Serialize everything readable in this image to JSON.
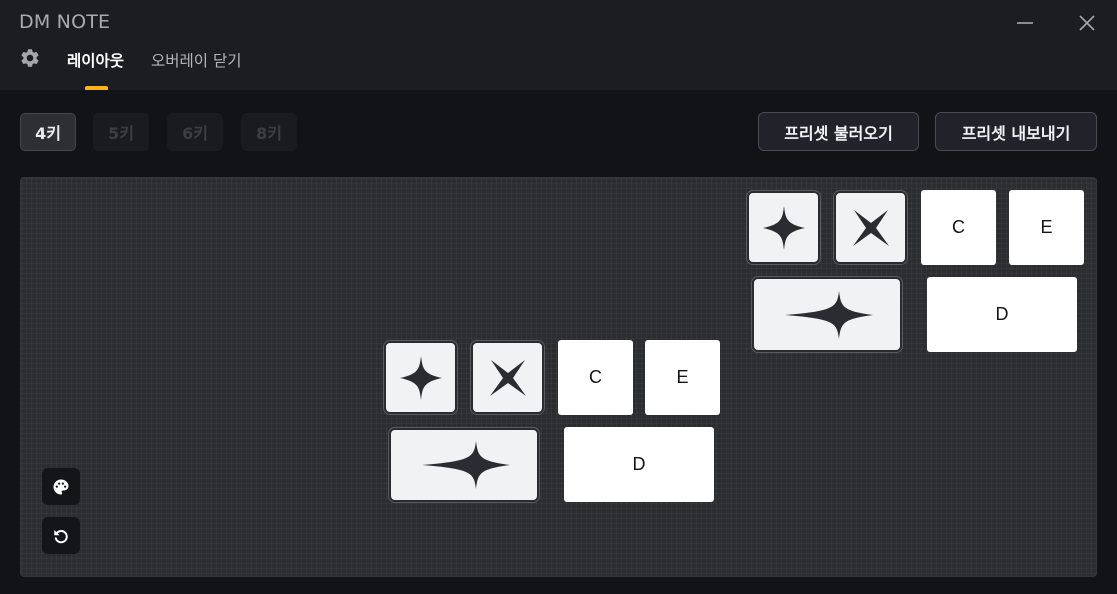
{
  "window": {
    "title": "DM NOTE",
    "minimize_icon": "minimize-icon",
    "close_icon": "close-icon"
  },
  "nav": {
    "settings_icon": "gear-icon",
    "tabs": [
      {
        "label": "레이아웃",
        "active": true
      },
      {
        "label": "오버레이 닫기",
        "active": false
      }
    ],
    "accent_color": "#ffb31a"
  },
  "key_modes": [
    {
      "label": "4키",
      "active": true
    },
    {
      "label": "5키",
      "active": false
    },
    {
      "label": "6키",
      "active": false
    },
    {
      "label": "8키",
      "active": false
    }
  ],
  "presets": {
    "load_label": "프리셋 불러오기",
    "export_label": "프리셋 내보내기"
  },
  "canvas": {
    "key_groups": [
      {
        "keys": [
          {
            "type": "icon",
            "icon": "four-point-star-icon"
          },
          {
            "type": "icon",
            "icon": "x-cross-icon"
          },
          {
            "type": "text",
            "label": "C"
          },
          {
            "type": "text",
            "label": "E"
          },
          {
            "type": "icon",
            "icon": "wide-star-icon"
          },
          {
            "type": "text",
            "label": "D"
          }
        ]
      },
      {
        "keys": [
          {
            "type": "icon",
            "icon": "four-point-star-icon"
          },
          {
            "type": "icon",
            "icon": "x-cross-icon"
          },
          {
            "type": "text",
            "label": "C"
          },
          {
            "type": "text",
            "label": "E"
          },
          {
            "type": "icon",
            "icon": "wide-star-icon"
          },
          {
            "type": "text",
            "label": "D"
          }
        ]
      }
    ],
    "tools": [
      {
        "icon": "palette-icon"
      },
      {
        "icon": "undo-icon"
      }
    ]
  }
}
